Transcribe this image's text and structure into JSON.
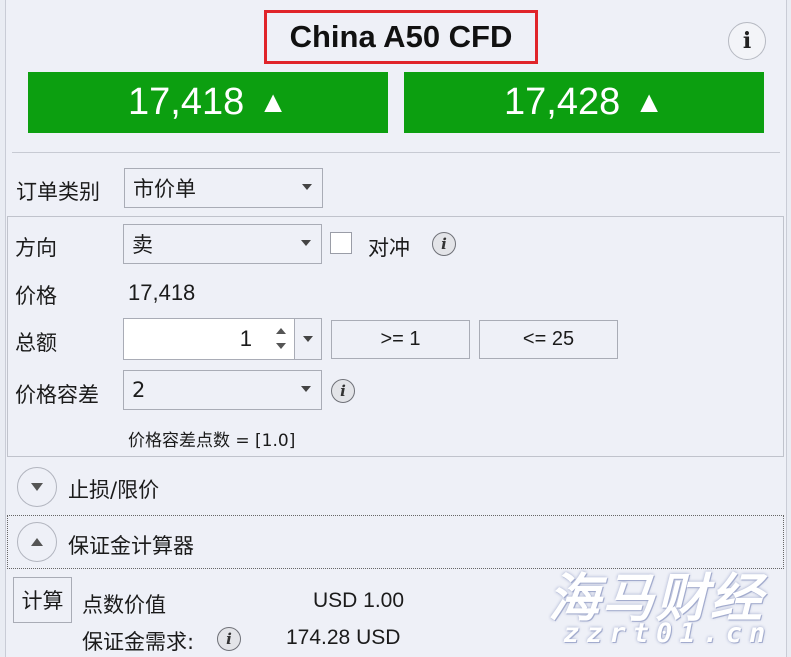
{
  "title": "China A50 CFD",
  "info_label": "i",
  "prices": {
    "sell": "17,418",
    "buy": "17,428",
    "direction_arrow": "▲",
    "color": "#0c9f10"
  },
  "order_type": {
    "label": "订单类别",
    "value": "市价单"
  },
  "direction": {
    "label": "方向",
    "value": "卖",
    "hedge_label": "对冲",
    "hedge_checked": false
  },
  "price": {
    "label": "价格",
    "value": "17,418"
  },
  "amount": {
    "label": "总额",
    "value": "1",
    "min_label": ">= 1",
    "max_label": "<= 25"
  },
  "tolerance": {
    "label": "价格容差",
    "value": "2",
    "points_text": "价格容差点数 = [1.0]"
  },
  "sections": {
    "stop_limit": "止损/限价",
    "margin_calc": "保证金计算器"
  },
  "calculator": {
    "calc_button": "计算",
    "pip_value_label": "点数价值",
    "pip_value": "USD 1.00",
    "margin_req_label": "保证金需求:",
    "margin_req": "174.28 USD"
  },
  "watermark": {
    "brand": "海马财经",
    "url": "zzrt01.cn"
  }
}
